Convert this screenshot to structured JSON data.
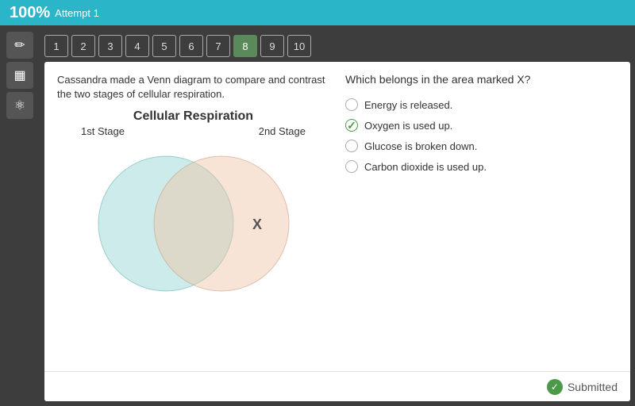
{
  "topBar": {
    "score": "100%",
    "attempt": "Attempt 1"
  },
  "sidebar": {
    "icons": [
      {
        "name": "pencil-icon",
        "symbol": "✏"
      },
      {
        "name": "calculator-icon",
        "symbol": "▦"
      },
      {
        "name": "atom-icon",
        "symbol": "⚛"
      }
    ]
  },
  "questionNav": {
    "buttons": [
      "1",
      "2",
      "3",
      "4",
      "5",
      "6",
      "7",
      "8",
      "9",
      "10"
    ],
    "activeIndex": 7
  },
  "question": {
    "description": "Cassandra made a Venn diagram to compare and contrast the two stages of cellular respiration.",
    "diagramTitle": "Cellular Respiration",
    "stage1Label": "1st Stage",
    "stage2Label": "2nd Stage",
    "xLabel": "X",
    "questionText": "Which belongs in the area marked X?",
    "options": [
      {
        "id": "a",
        "text": "Energy is released.",
        "selected": false,
        "correct": false
      },
      {
        "id": "b",
        "text": "Oxygen is used up.",
        "selected": true,
        "correct": true
      },
      {
        "id": "c",
        "text": "Glucose is broken down.",
        "selected": false,
        "correct": false
      },
      {
        "id": "d",
        "text": "Carbon dioxide is used up.",
        "selected": false,
        "correct": false
      }
    ]
  },
  "footer": {
    "submittedLabel": "Submitted"
  }
}
